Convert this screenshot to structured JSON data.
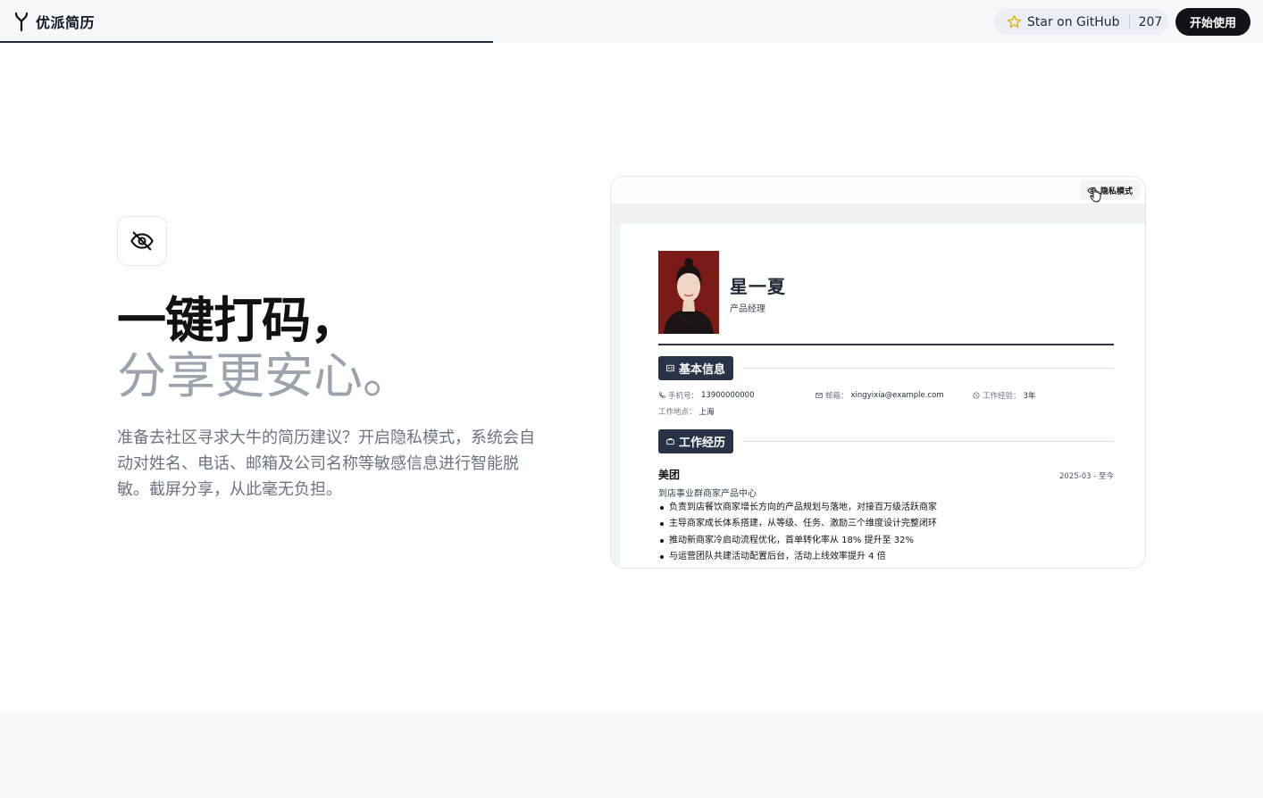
{
  "header": {
    "brand_name": "优派简历",
    "github_label": "Star on GitHub",
    "github_stars": "207",
    "start_button": "开始使用"
  },
  "feature": {
    "icon": "eye-off-icon",
    "headline_line1": "一键打码，",
    "headline_line2": "分享更安心。",
    "description": "准备去社区寻求大牛的简历建议？开启隐私模式，系统会自动对姓名、电话、邮箱及公司名称等敏感信息进行智能脱敏。截屏分享，从此毫无负担。"
  },
  "preview": {
    "privacy_toggle_label": "隐私模式",
    "resume": {
      "name": "星一夏",
      "role": "产品经理",
      "basic_info_title": "基本信息",
      "phone_label": "手机号：",
      "phone_value": "13900000000",
      "email_label": "邮箱：",
      "email_value": "xingyixia@example.com",
      "experience_label": "工作经验：",
      "experience_value": "3年",
      "location_label": "工作地点：",
      "location_value": "上海",
      "work_title": "工作经历",
      "company": "美团",
      "period": "2025-03 - 至今",
      "department": "到店事业群商家产品中心",
      "bullets": [
        "负责到店餐饮商家增长方向的产品规划与落地，对接百万级活跃商家",
        "主导商家成长体系搭建，从等级、任务、激励三个维度设计完整闭环",
        "推动新商家冷启动流程优化，首单转化率从 18% 提升至 32%",
        "与运营团队共建活动配置后台，活动上线效率提升 4 倍"
      ]
    }
  },
  "colors": {
    "accent_dark": "#111318",
    "section_tag": "#273448",
    "star": "#e0b400"
  }
}
